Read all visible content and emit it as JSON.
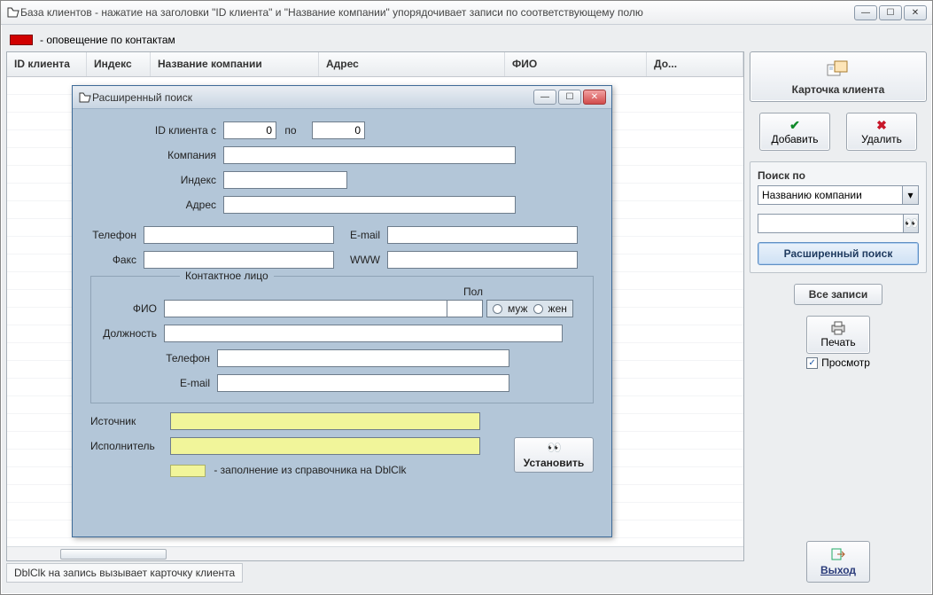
{
  "window": {
    "title": "База клиентов - нажатие на заголовки \"ID клиента\" и \"Название компании\" упорядочивает записи по соответствующему полю",
    "legend": "- оповещение по контактам",
    "status": "DblClk на запись вызывает карточку клиента"
  },
  "grid": {
    "cols": {
      "id": "ID клиента",
      "index": "Индекс",
      "company": "Название компании",
      "address": "Адрес",
      "fio": "ФИО",
      "pos": "До..."
    }
  },
  "sidebar": {
    "card": "Карточка клиента",
    "add": "Добавить",
    "del": "Удалить",
    "search_by": "Поиск по",
    "search_by_value": "Названию компании",
    "adv_search": "Расширенный поиск",
    "all_records": "Все записи",
    "print": "Печать",
    "preview": "Просмотр",
    "exit": "Выход"
  },
  "dialog": {
    "title": "Расширенный поиск",
    "id_from": "ID клиента с",
    "id_from_v": "0",
    "to": "по",
    "id_to_v": "0",
    "company": "Компания",
    "index": "Индекс",
    "address": "Адрес",
    "phone": "Телефон",
    "fax": "Факс",
    "email": "E-mail",
    "www": "WWW",
    "contact_legend": "Контактное лицо",
    "fio": "ФИО",
    "pol": "Пол",
    "male": "муж",
    "female": "жен",
    "position": "Должность",
    "c_phone": "Телефон",
    "c_email": "E-mail",
    "source": "Источник",
    "executor": "Исполнитель",
    "yellow_hint": "- заполнение из справочника на DblClk",
    "set": "Установить"
  }
}
